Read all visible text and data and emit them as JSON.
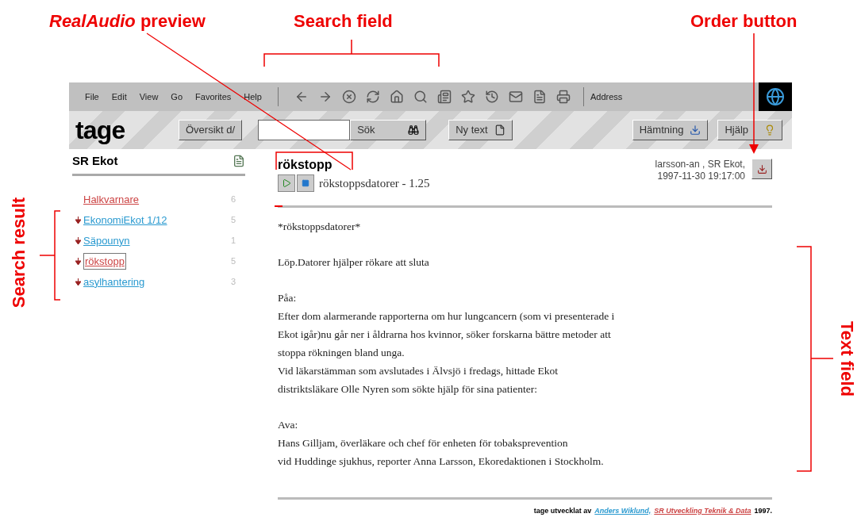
{
  "annotations": [
    {
      "kind": "top",
      "text": "*RealAudio* preview"
    },
    {
      "kind": "top",
      "text": "Search field"
    },
    {
      "kind": "top",
      "text": "Order button"
    },
    {
      "kind": "left",
      "text": "Search result"
    },
    {
      "kind": "right",
      "text": "Text field"
    }
  ],
  "browser": {
    "menu": [
      "File",
      "Edit",
      "View",
      "Go",
      "Favorites",
      "Help"
    ],
    "address_label": "Address"
  },
  "header": {
    "logo": "tage",
    "overview_button": "Översikt d/",
    "search_button": "Sök",
    "new_text_button": "Ny text",
    "download_button": "Hämtning",
    "help_button": "Hjälp"
  },
  "sidebar": {
    "title": "SR Ekot",
    "items": [
      {
        "label": "Halkvarnare",
        "count": "6",
        "visited": true,
        "marker": false,
        "selected": false
      },
      {
        "label": "EkonomiEkot 1/12",
        "count": "5",
        "visited": false,
        "marker": true,
        "selected": false
      },
      {
        "label": "Säpounyn",
        "count": "1",
        "visited": false,
        "marker": true,
        "selected": false
      },
      {
        "label": "rökstopp",
        "count": "5",
        "visited": true,
        "marker": true,
        "selected": true
      },
      {
        "label": "asylhantering",
        "count": "3",
        "visited": false,
        "marker": true,
        "selected": false
      }
    ]
  },
  "article": {
    "title": "rökstopp",
    "audio_label": "rökstoppsdatorer - 1.25",
    "author": "larsson-an , SR Ekot,",
    "date": "1997-11-30 19:17:00",
    "paragraphs": [
      [
        "*rökstoppsdatorer*"
      ],
      [
        "Löp.Datorer hjälper rökare att sluta"
      ],
      [
        "Påa:",
        "Efter dom alarmerande rapporterna om hur lungcancern (som vi presenterade i",
        "Ekot igår)nu går ner i åldrarna hos kvinnor, söker forskarna bättre metoder att",
        "stoppa rökningen bland unga.",
        "Vid läkarstämman som avslutades i Älvsjö i fredags, hittade Ekot",
        "distriktsläkare Olle Nyren som sökte hjälp för sina patienter:"
      ],
      [
        "Ava:",
        "Hans Gilljam, överläkare och chef för enheten för tobaksprevention",
        "vid Huddinge sjukhus, reporter Anna Larsson, Ekoredaktionen i Stockholm."
      ]
    ]
  },
  "footer": {
    "text": "tage utvecklat av",
    "link_1": "Anders Wiklund,",
    "link_2": "SR Utveckling Teknik & Data",
    "year": "1997."
  }
}
